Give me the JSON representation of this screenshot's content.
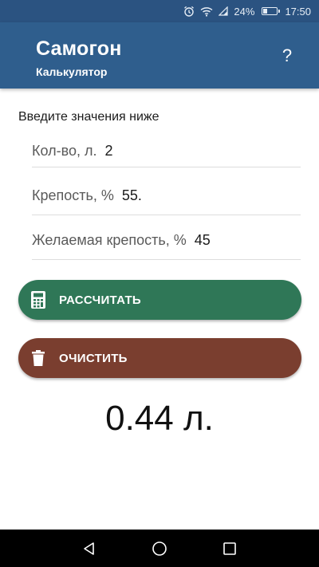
{
  "status_bar": {
    "battery_percent_text": "24%",
    "battery_level": 0.24,
    "time": "17:50",
    "icons": [
      "alarm-icon",
      "wifi-icon",
      "signal-icon",
      "battery-icon"
    ]
  },
  "toolbar": {
    "title": "Самогон",
    "subtitle": "Калькулятор",
    "help_label": "?"
  },
  "form": {
    "prompt": "Введите значения ниже",
    "fields": [
      {
        "label": "Кол-во, л.",
        "value": "2"
      },
      {
        "label": "Крепость, %",
        "value": "55."
      },
      {
        "label": "Желаемая крепость, %",
        "value": "45"
      }
    ]
  },
  "buttons": {
    "calculate_label": "РАССЧИТАТЬ",
    "calculate_icon": "calculator-icon",
    "calculate_color": "#2f7757",
    "clear_label": "ОЧИСТИТЬ",
    "clear_icon": "trash-icon",
    "clear_color": "#7a3e2f"
  },
  "result": "0.44 л.",
  "nav_bar": {
    "icons": [
      "back-icon",
      "home-icon",
      "recents-icon"
    ]
  },
  "colors": {
    "toolbar": "#2f5e8d",
    "status_bar": "#2b5381"
  }
}
